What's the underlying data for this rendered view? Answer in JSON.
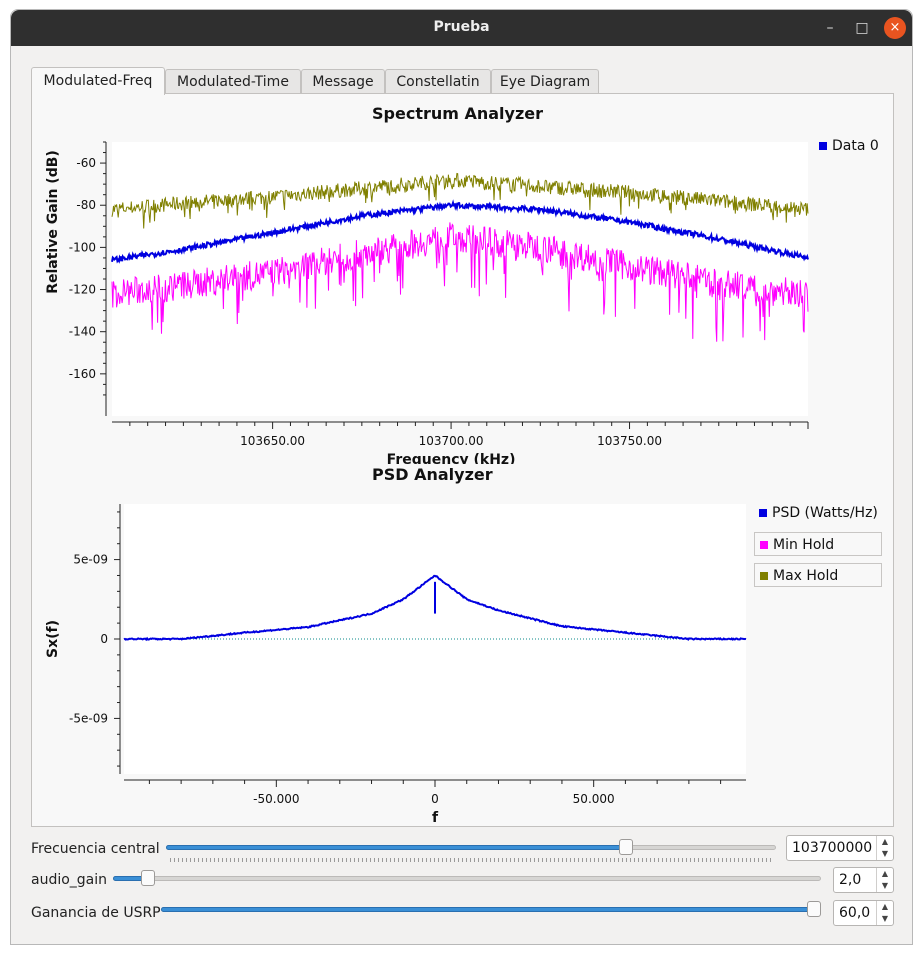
{
  "window": {
    "title": "Prueba",
    "minimize": "–",
    "maximize": "□",
    "close": "×"
  },
  "tabs": [
    {
      "label": "Modulated-Freq",
      "active": true
    },
    {
      "label": "Modulated-Time"
    },
    {
      "label": "Message"
    },
    {
      "label": "Constellatin"
    },
    {
      "label": "Eye Diagram"
    }
  ],
  "spectrum": {
    "title": "Spectrum Analyzer",
    "legend": "Data 0",
    "chart_data": {
      "type": "line",
      "title": "Spectrum Analyzer",
      "xlabel": "Frequency (kHz)",
      "ylabel": "Relative Gain (dB)",
      "xlim": [
        103605,
        103800
      ],
      "ylim": [
        -180,
        -50
      ],
      "x_ticks": [
        "103650.00",
        "103700.00",
        "103750.00"
      ],
      "y_ticks": [
        "-60",
        "-80",
        "-100",
        "-120",
        "-140",
        "-160"
      ],
      "series": [
        {
          "name": "Data 0",
          "color": "#0000e0",
          "x": [
            103605,
            103625,
            103650,
            103675,
            103700,
            103725,
            103750,
            103775,
            103800
          ],
          "values": [
            -106,
            -101,
            -93,
            -85,
            -80,
            -82,
            -88,
            -96,
            -105
          ]
        },
        {
          "color": "#808000",
          "x": [
            103605,
            103625,
            103650,
            103675,
            103700,
            103725,
            103750,
            103775,
            103800
          ],
          "values": [
            -82,
            -79,
            -76,
            -72,
            -68,
            -71,
            -74,
            -78,
            -82
          ]
        },
        {
          "color": "#ff00ff",
          "x": [
            103605,
            103625,
            103650,
            103675,
            103700,
            103725,
            103750,
            103775,
            103800
          ],
          "values": [
            -122,
            -118,
            -112,
            -103,
            -95,
            -100,
            -109,
            -117,
            -122
          ]
        }
      ]
    }
  },
  "psd": {
    "title": "PSD Analyzer",
    "legend": [
      {
        "label": "PSD (Watts/Hz)",
        "color": "#0000e0"
      },
      {
        "label": "Min Hold",
        "color": "#ff00ff"
      },
      {
        "label": "Max Hold",
        "color": "#808000"
      }
    ],
    "chart_data": {
      "type": "line",
      "title": "PSD Analyzer",
      "xlabel": "f",
      "ylabel": "Sx(f)",
      "xlim": [
        -98,
        98
      ],
      "ylim": [
        -8.5e-09,
        8.5e-09
      ],
      "x_ticks": [
        "-50.000",
        "0",
        "50.000"
      ],
      "y_ticks": [
        "5e-09",
        "0",
        "-5e-09"
      ],
      "series": [
        {
          "name": "PSD (Watts/Hz)",
          "x": [
            -98,
            -80,
            -60,
            -40,
            -20,
            -10,
            0,
            10,
            20,
            40,
            60,
            80,
            98
          ],
          "values": [
            0.0,
            0.0,
            4e-10,
            7.5e-10,
            1.6e-09,
            2.5e-09,
            4e-09,
            2.5e-09,
            1.8e-09,
            8e-10,
            4e-10,
            0.0,
            0.0
          ]
        }
      ]
    }
  },
  "controls": [
    {
      "label": "Frecuencia central",
      "value": "103700000",
      "fraction": 0.76
    },
    {
      "label": "audio_gain",
      "value": "2,0",
      "fraction": 0.04
    },
    {
      "label": "Ganancia de USRP",
      "value": "60,0",
      "fraction": 1.0
    }
  ],
  "spin_up": "▲",
  "spin_down": "▼"
}
